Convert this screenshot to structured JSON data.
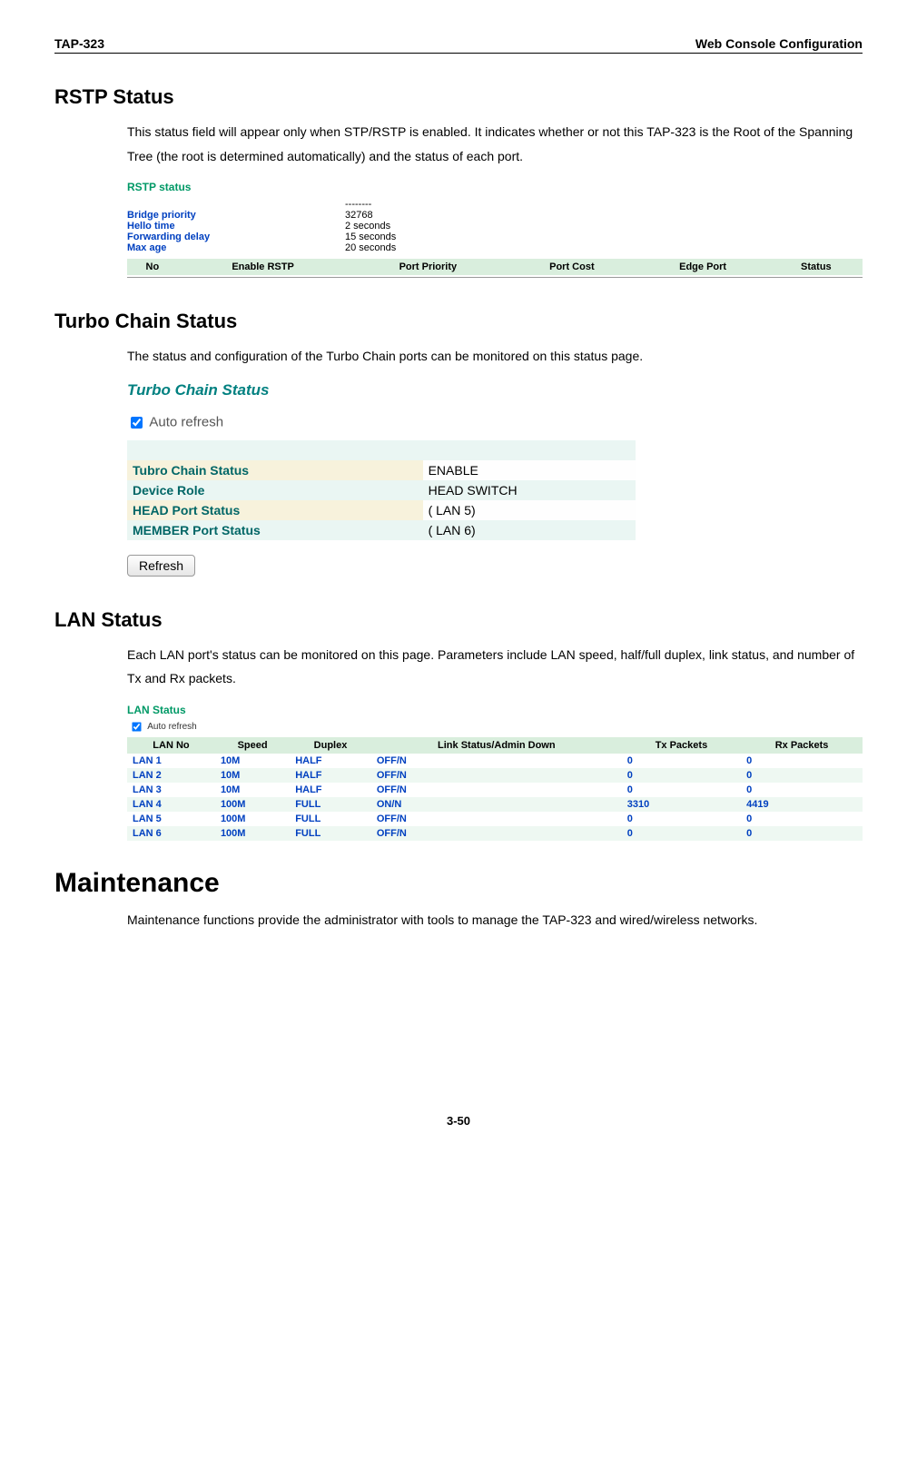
{
  "header": {
    "left": "TAP-323",
    "right": "Web Console Configuration"
  },
  "rstp": {
    "heading": "RSTP Status",
    "intro": "This status field will appear only when STP/RSTP is enabled. It indicates whether or not this TAP-323 is the Root of the Spanning Tree (the root is determined automatically) and the status of each port.",
    "shot": {
      "title": "RSTP status",
      "params": [
        {
          "k": "Bridge priority",
          "v": "32768"
        },
        {
          "k": "Hello time",
          "v": "2 seconds"
        },
        {
          "k": "Forwarding delay",
          "v": "15 seconds"
        },
        {
          "k": "Max age",
          "v": "20 seconds"
        }
      ],
      "dashes": "--------",
      "cols": [
        "No",
        "Enable RSTP",
        "Port Priority",
        "Port Cost",
        "Edge Port",
        "Status"
      ]
    }
  },
  "tcs": {
    "heading": "Turbo Chain Status",
    "intro": "The status and configuration of the Turbo Chain ports can be monitored on this status page.",
    "shot": {
      "title": "Turbo Chain Status",
      "auto_refresh": "Auto refresh",
      "rows": [
        {
          "k": "Tubro Chain Status",
          "v": "ENABLE"
        },
        {
          "k": "Device Role",
          "v": "HEAD SWITCH"
        },
        {
          "k": "HEAD Port Status",
          "v": "( LAN 5)"
        },
        {
          "k": "MEMBER Port Status",
          "v": "( LAN 6)"
        }
      ],
      "refresh": "Refresh"
    }
  },
  "lan": {
    "heading": "LAN Status",
    "intro": "Each LAN port's status can be monitored on this page. Parameters include LAN speed, half/full duplex, link status, and number of Tx and Rx packets.",
    "shot": {
      "title": "LAN Status",
      "auto_refresh": "Auto refresh",
      "cols": [
        "LAN No",
        "Speed",
        "Duplex",
        "Link Status/Admin Down",
        "Tx Packets",
        "Rx Packets"
      ],
      "rows": [
        [
          "LAN 1",
          "10M",
          "HALF",
          "OFF/N",
          "0",
          "0"
        ],
        [
          "LAN 2",
          "10M",
          "HALF",
          "OFF/N",
          "0",
          "0"
        ],
        [
          "LAN 3",
          "10M",
          "HALF",
          "OFF/N",
          "0",
          "0"
        ],
        [
          "LAN 4",
          "100M",
          "FULL",
          "ON/N",
          "3310",
          "4419"
        ],
        [
          "LAN 5",
          "100M",
          "FULL",
          "OFF/N",
          "0",
          "0"
        ],
        [
          "LAN 6",
          "100M",
          "FULL",
          "OFF/N",
          "0",
          "0"
        ]
      ]
    }
  },
  "maint": {
    "heading": "Maintenance",
    "intro": "Maintenance functions provide the administrator with tools to manage the TAP-323 and wired/wireless networks."
  },
  "page_num": "3-50"
}
